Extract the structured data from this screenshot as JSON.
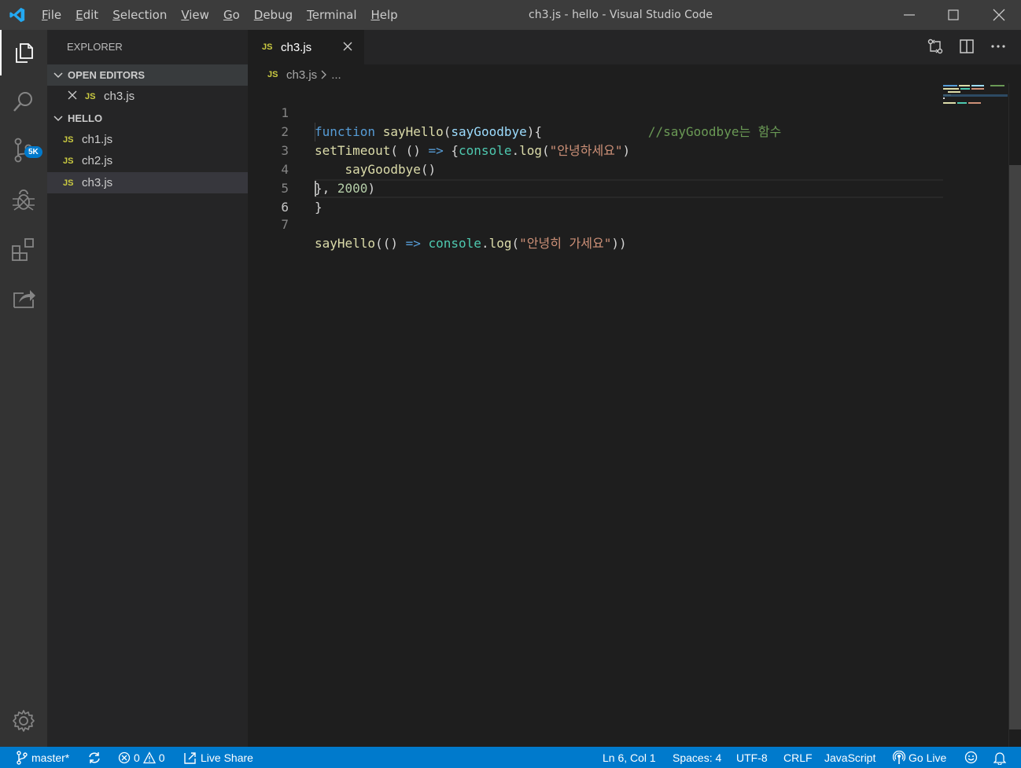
{
  "window": {
    "title": "ch3.js - hello - Visual Studio Code"
  },
  "menu": [
    {
      "label": "File",
      "mn": "F",
      "rest": "ile"
    },
    {
      "label": "Edit",
      "mn": "E",
      "rest": "dit"
    },
    {
      "label": "Selection",
      "mn": "S",
      "rest": "election"
    },
    {
      "label": "View",
      "mn": "V",
      "rest": "iew"
    },
    {
      "label": "Go",
      "mn": "G",
      "rest": "o"
    },
    {
      "label": "Debug",
      "mn": "D",
      "rest": "ebug"
    },
    {
      "label": "Terminal",
      "mn": "T",
      "rest": "erminal"
    },
    {
      "label": "Help",
      "mn": "H",
      "rest": "elp"
    }
  ],
  "activity": {
    "scm_badge": "5K"
  },
  "explorer": {
    "title": "EXPLORER",
    "open_editors_label": "OPEN EDITORS",
    "open_editors": [
      {
        "icon": "JS",
        "name": "ch3.js"
      }
    ],
    "folder_label": "HELLO",
    "files": [
      {
        "icon": "JS",
        "name": "ch1.js"
      },
      {
        "icon": "JS",
        "name": "ch2.js"
      },
      {
        "icon": "JS",
        "name": "ch3.js"
      }
    ]
  },
  "tab": {
    "icon": "JS",
    "name": "ch3.js"
  },
  "breadcrumb": {
    "icon": "JS",
    "file": "ch3.js",
    "rest": "..."
  },
  "code": {
    "line_numbers": [
      "1",
      "2",
      "3",
      "4",
      "5",
      "6",
      "7"
    ],
    "l1": {
      "kw": "function",
      "sp1": " ",
      "fn": "sayHello",
      "p1": "(",
      "param": "sayGoodbye",
      "p2": "){",
      "pad": "              ",
      "comment": "//sayGoodbye는 함수"
    },
    "l2": {
      "fn": "setTimeout",
      "p1": "( () ",
      "arrow": "=>",
      "p2": " {",
      "obj": "console",
      "dot": ".",
      "fn2": "log",
      "p3": "(",
      "str": "\"안녕하세요\"",
      "p4": ")"
    },
    "l3": {
      "indent": "    ",
      "fn": "sayGoodbye",
      "p1": "()"
    },
    "l4": {
      "p1": "}, ",
      "num": "2000",
      "p2": ")"
    },
    "l5": {
      "p1": "}"
    },
    "l7": {
      "fn": "sayHello",
      "p1": "(() ",
      "arrow": "=>",
      "sp": " ",
      "obj": "console",
      "dot": ".",
      "fn2": "log",
      "p2": "(",
      "str": "\"안녕히 가세요\"",
      "p3": "))"
    }
  },
  "status": {
    "branch": "master*",
    "errors": "0",
    "warnings": "0",
    "live_share": "Live Share",
    "position": "Ln 6, Col 1",
    "spaces": "Spaces: 4",
    "encoding": "UTF-8",
    "eol": "CRLF",
    "language": "JavaScript",
    "go_live": "Go Live"
  },
  "colors": {
    "accent": "#007acc",
    "titlebar": "#3c3c3c",
    "activitybar": "#333333",
    "sidebar": "#252526",
    "editor": "#1e1e1e"
  }
}
